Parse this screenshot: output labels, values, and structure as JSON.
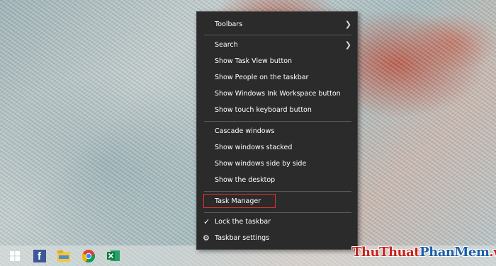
{
  "context_menu": {
    "items": [
      {
        "label": "Toolbars",
        "submenu": true
      },
      {
        "label": "Search",
        "submenu": true
      },
      {
        "label": "Show Task View button"
      },
      {
        "label": "Show People on the taskbar"
      },
      {
        "label": "Show Windows Ink Workspace button"
      },
      {
        "label": "Show touch keyboard button"
      },
      {
        "label": "Cascade windows"
      },
      {
        "label": "Show windows stacked"
      },
      {
        "label": "Show windows side by side"
      },
      {
        "label": "Show the desktop"
      },
      {
        "label": "Task Manager",
        "highlighted": true
      },
      {
        "label": "Lock the taskbar",
        "checked": true
      },
      {
        "label": "Taskbar settings",
        "icon": "gear-icon"
      }
    ],
    "highlight_color": "#e0302a"
  },
  "taskbar": {
    "icons": [
      "windows-start-icon",
      "facebook-icon",
      "file-explorer-icon",
      "chrome-icon",
      "excel-icon"
    ],
    "facebook_glyph": "f"
  },
  "watermark": {
    "part1": "ThuThuat",
    "part2": "PhanMem",
    "part3": ".vn",
    "color1": "#c8221b",
    "color2": "#1d5fa8"
  }
}
